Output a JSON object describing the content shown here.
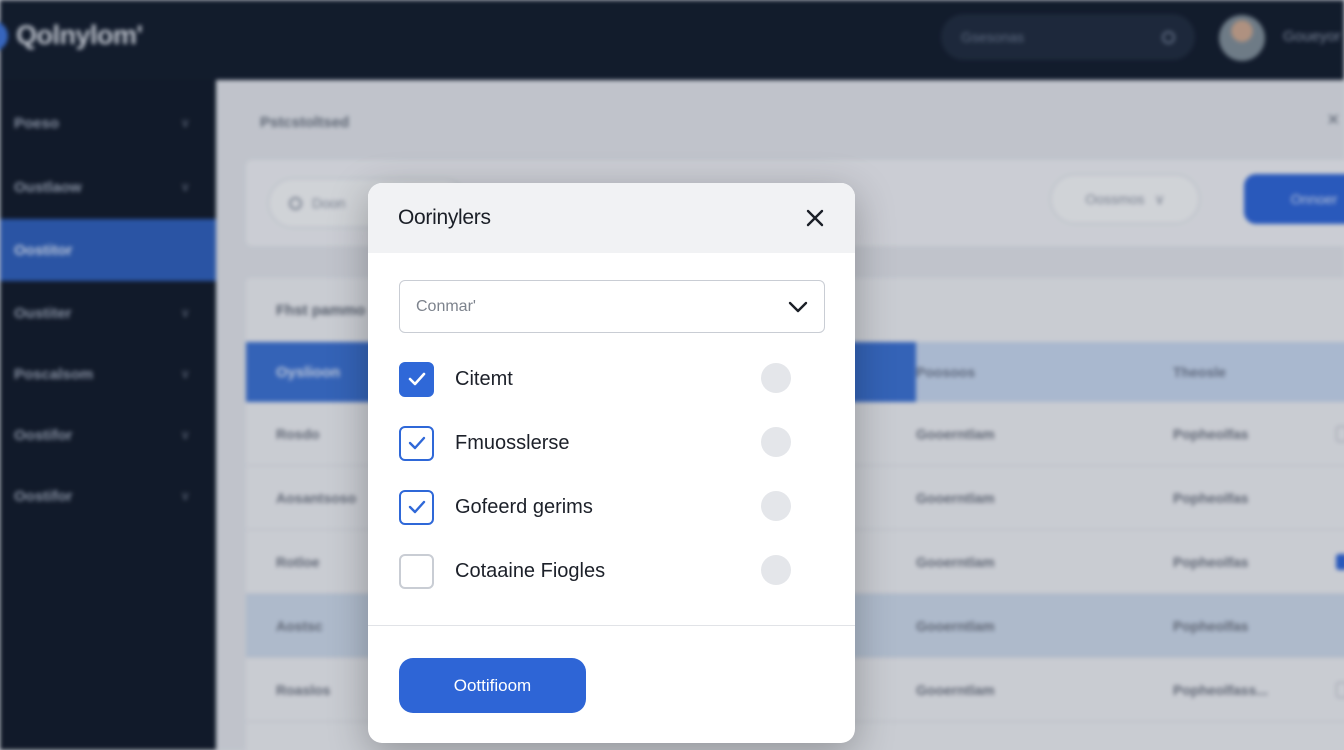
{
  "app": {
    "logo_text": "Qolnylom'",
    "top_search_placeholder": "Gsesonas",
    "user_name": "Goueyor"
  },
  "sidebar": {
    "items": [
      {
        "label": "Poeso"
      },
      {
        "label": "Oustlaow"
      },
      {
        "label": "Oostitor"
      },
      {
        "label": "Oustiter"
      },
      {
        "label": "Poscalsom"
      },
      {
        "label": "Oostifor"
      },
      {
        "label": "Oostifor"
      }
    ]
  },
  "content": {
    "breadcrumb": "Pstcstoltsed",
    "filter": {
      "search_placeholder": "Doon",
      "select_label": "Oossmos",
      "button_label": "Onnoer"
    },
    "table": {
      "title": "Fhst pammo",
      "headers": [
        "Oyslioon",
        "Poosoos",
        "Theosle"
      ],
      "rows": [
        [
          "Rosdo",
          "Gooerntlam",
          "Popheolfas"
        ],
        [
          "Aosantsoso",
          "Gooerntlam",
          "Popheolfas"
        ],
        [
          "Rotloe",
          "Gooerntlam",
          "Popheolfas"
        ],
        [
          "Aostsc",
          "Gooerntlam",
          "Popheolfas"
        ],
        [
          "Roaslos",
          "Gooerntlam",
          "Popheolfass..."
        ]
      ]
    }
  },
  "modal": {
    "title": "Oorinylers",
    "select": {
      "value": "Conmar'"
    },
    "options": [
      {
        "label": "Citemt",
        "checked": true
      },
      {
        "label": "Fmuosslerse",
        "checked": true
      },
      {
        "label": "Gofeerd gerims",
        "checked": true
      },
      {
        "label": "Cotaaine Fiogles",
        "checked": false
      }
    ],
    "primary_button": "Oottifioom"
  },
  "colors": {
    "accent": "#2e65d6",
    "sidebar_bg": "#111a2a",
    "topbar_bg": "#121c2d"
  }
}
